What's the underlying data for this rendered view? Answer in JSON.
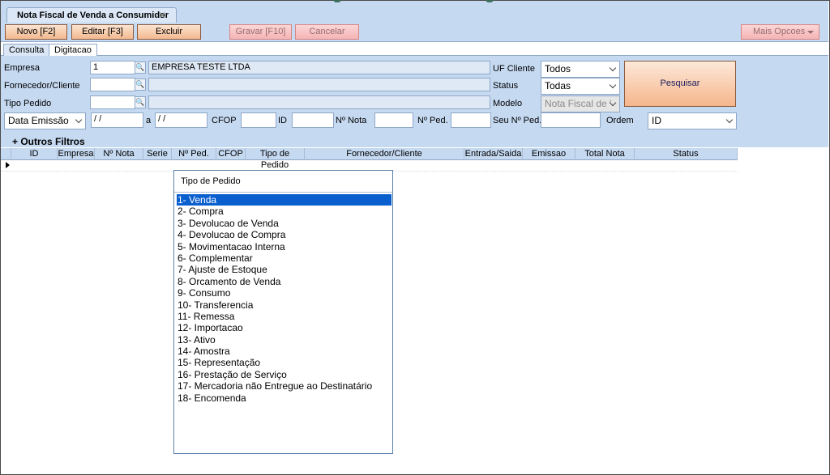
{
  "window": {
    "doc_tab_title": "Nota Fiscal de Venda a Consumidor",
    "close_glyph": "✕"
  },
  "toolbar": {
    "novo": "Novo [F2]",
    "editar": "Editar [F3]",
    "excluir": "Excluir",
    "gravar": "Gravar [F10]",
    "cancelar": "Cancelar",
    "mais_opcoes": "Mais Opcoes"
  },
  "subtabs": {
    "consulta": "Consulta",
    "digitacao": "Digitacao"
  },
  "form": {
    "empresa_label": "Empresa",
    "empresa_code": "1",
    "empresa_name": "EMPRESA TESTE LTDA",
    "fornecedor_label": "Fornecedor/Cliente",
    "tipo_pedido_label": "Tipo Pedido",
    "uf_label": "UF Cliente",
    "uf_value": "Todos",
    "status_label": "Status",
    "status_value": "Todas",
    "modelo_label": "Modelo",
    "modelo_value": "Nota Fiscal de '",
    "date_type": "Data Emissão",
    "date_from": "/ /",
    "date_sep": "a",
    "date_to": "/ /",
    "cfop_label": "CFOP",
    "id_label": "ID",
    "nota_label": "Nº Nota",
    "ped_label": "Nº Ped.",
    "seu_ped_label": "Seu Nº Ped.",
    "ordem_label": "Ordem",
    "ordem_value": "ID",
    "pesquisar": "Pesquisar",
    "outros_filtros": "+  Outros Filtros"
  },
  "grid": {
    "columns": [
      "ID",
      "Empresa",
      "Nº Nota",
      "Serie",
      "Nº Ped.",
      "CFOP",
      "Tipo de Pedido",
      "Fornecedor/Cliente",
      "Entrada/Saida",
      "Emissao",
      "Total Nota",
      "Status"
    ]
  },
  "dropdown": {
    "title": "Tipo de Pedido",
    "selected_index": 0,
    "items": [
      "1- Venda",
      "2- Compra",
      "3- Devolucao de Venda",
      "4- Devolucao de Compra",
      "5- Movimentacao Interna",
      "6- Complementar",
      "7- Ajuste de Estoque",
      "8- Orcamento de Venda",
      "9- Consumo",
      "10- Transferencia",
      "11- Remessa",
      "12- Importacao",
      "13- Ativo",
      "14- Amostra",
      "15- Representação",
      "16- Prestação de Serviço",
      "17- Mercadoria não Entregue ao Destinatário",
      "18- Encomenda"
    ]
  }
}
